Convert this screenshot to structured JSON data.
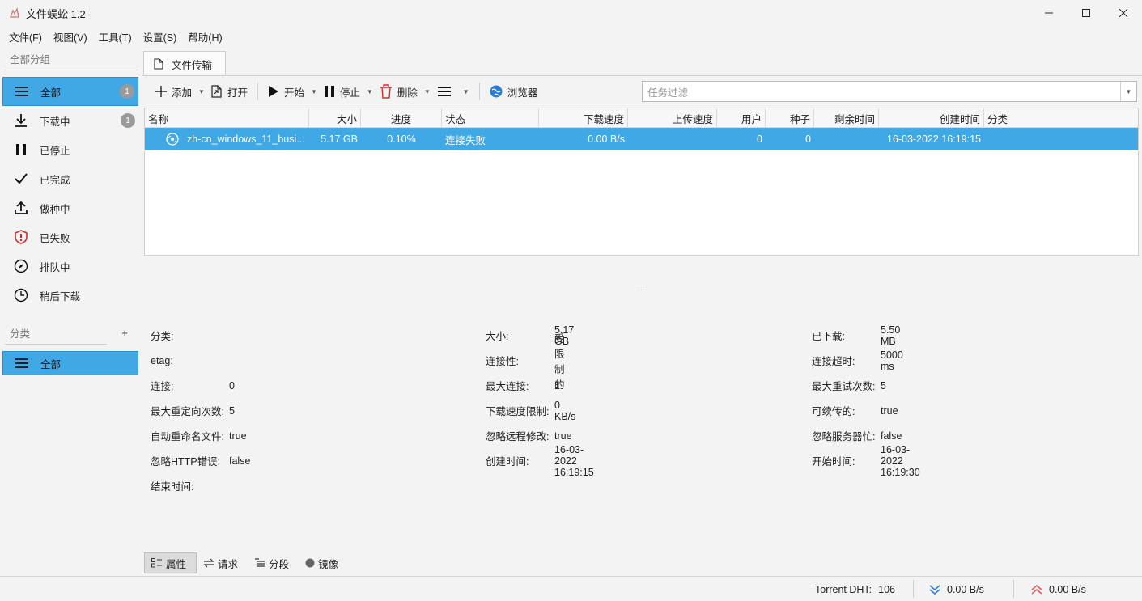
{
  "window": {
    "title": "文件蜈蚣 1.2"
  },
  "menu": [
    "文件(F)",
    "视图(V)",
    "工具(T)",
    "设置(S)",
    "帮助(H)"
  ],
  "sidebar": {
    "groups_header": "全部分组",
    "items": [
      {
        "label": "全部",
        "badge": "1",
        "icon": "menu-icon"
      },
      {
        "label": "下载中",
        "badge": "1",
        "icon": "download-icon"
      },
      {
        "label": "已停止",
        "icon": "pause-icon"
      },
      {
        "label": "已完成",
        "icon": "check-icon"
      },
      {
        "label": "做种中",
        "icon": "upload-icon"
      },
      {
        "label": "已失败",
        "icon": "shield-alert-icon"
      },
      {
        "label": "排队中",
        "icon": "compass-icon"
      },
      {
        "label": "稍后下载",
        "icon": "clock-icon"
      }
    ],
    "categories_header": "分类",
    "categories_add": "+",
    "categories": [
      {
        "label": "全部"
      }
    ]
  },
  "tab": {
    "label": "文件传输"
  },
  "toolbar": {
    "add": "添加",
    "open": "打开",
    "start": "开始",
    "stop": "停止",
    "delete": "删除",
    "browser": "浏览器",
    "filter_placeholder": "任务过滤"
  },
  "table": {
    "columns": [
      "名称",
      "大小",
      "进度",
      "状态",
      "下载速度",
      "上传速度",
      "用户",
      "种子",
      "剩余时间",
      "创建时间",
      "分类"
    ],
    "rows": [
      {
        "name": "zh-cn_windows_11_busi...",
        "size": "5.17 GB",
        "progress": "0.10%",
        "status": "连接失败",
        "down": "0.00 B/s",
        "up": "",
        "peers": "0",
        "seeds": "0",
        "remaining": "",
        "created": "16-03-2022 16:19:15",
        "category": ""
      }
    ]
  },
  "props": {
    "col1": [
      {
        "label": "分类:",
        "value": ""
      },
      {
        "label": "etag:",
        "value": ""
      },
      {
        "label": "连接:",
        "value": "0"
      },
      {
        "label": "最大重定向次数:",
        "value": "5"
      },
      {
        "label": "自动重命名文件:",
        "value": "true"
      },
      {
        "label": "忽略HTTP错误:",
        "value": "false"
      },
      {
        "label": "结束时间:",
        "value": ""
      }
    ],
    "col2": [
      {
        "label": "大小:",
        "value": "5.17 GB"
      },
      {
        "label": "连接性:",
        "value": "受限制的"
      },
      {
        "label": "最大连接:",
        "value": "1"
      },
      {
        "label": "下载速度限制:",
        "value": "0 KB/s"
      },
      {
        "label": "忽略远程修改:",
        "value": "true"
      },
      {
        "label": "创建时间:",
        "value": "16-03-2022 16:19:15"
      }
    ],
    "col3": [
      {
        "label": "已下载:",
        "value": "5.50 MB"
      },
      {
        "label": "连接超时:",
        "value": "5000 ms"
      },
      {
        "label": "最大重试次数:",
        "value": "5"
      },
      {
        "label": "可续传的:",
        "value": "true"
      },
      {
        "label": "忽略服务器忙:",
        "value": "false"
      },
      {
        "label": "开始时间:",
        "value": "16-03-2022 16:19:30"
      }
    ]
  },
  "bottom_tabs": [
    "属性",
    "请求",
    "分段",
    "镜像"
  ],
  "status": {
    "dht_label": "Torrent DHT:",
    "dht_value": "106",
    "down_speed": "0.00 B/s",
    "up_speed": "0.00 B/s"
  },
  "colors": {
    "accent": "#41a8e6",
    "badge": "#9a9a9a",
    "danger": "#d62b2b",
    "down": "#2a7fd4",
    "up": "#e25b5b"
  }
}
